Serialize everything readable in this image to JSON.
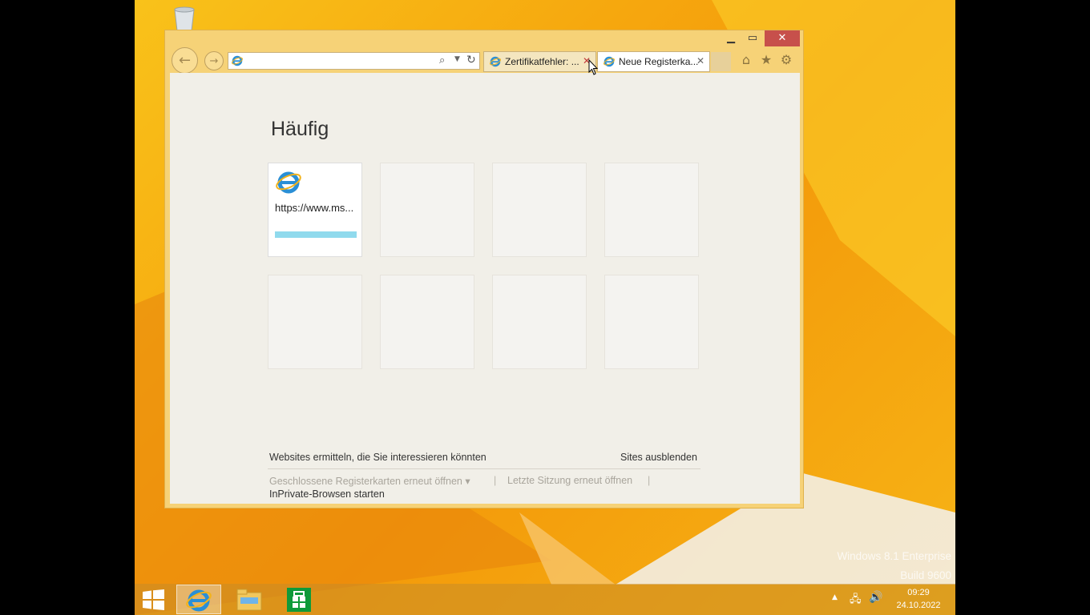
{
  "browser": {
    "address_value": "",
    "address_placeholder": "",
    "tabs": [
      {
        "label": "Zertifikatfehler: ..."
      },
      {
        "label": "Neue Registerka..."
      }
    ]
  },
  "new_tab_page": {
    "title": "Häufig",
    "tiles": [
      {
        "label": "https://www.ms..."
      }
    ],
    "footer": {
      "discover": "Websites ermitteln, die Sie interessieren könnten",
      "hide_sites": "Sites ausblenden",
      "reopen_tabs": "Geschlossene Registerkarten erneut öffnen ▾",
      "separator": "|",
      "reopen_session": "Letzte Sitzung erneut öffnen",
      "inprivate": "InPrivate-Browsen starten"
    }
  },
  "desktop": {
    "watermark_line1": "Windows 8.1 Enterprise",
    "watermark_line2": "Build 9600"
  },
  "taskbar": {
    "time": "09:29",
    "date": "24.10.2022"
  },
  "colors": {
    "accent": "#f6c244",
    "close_button": "#c7504b",
    "tile_bar": "#90daed"
  }
}
